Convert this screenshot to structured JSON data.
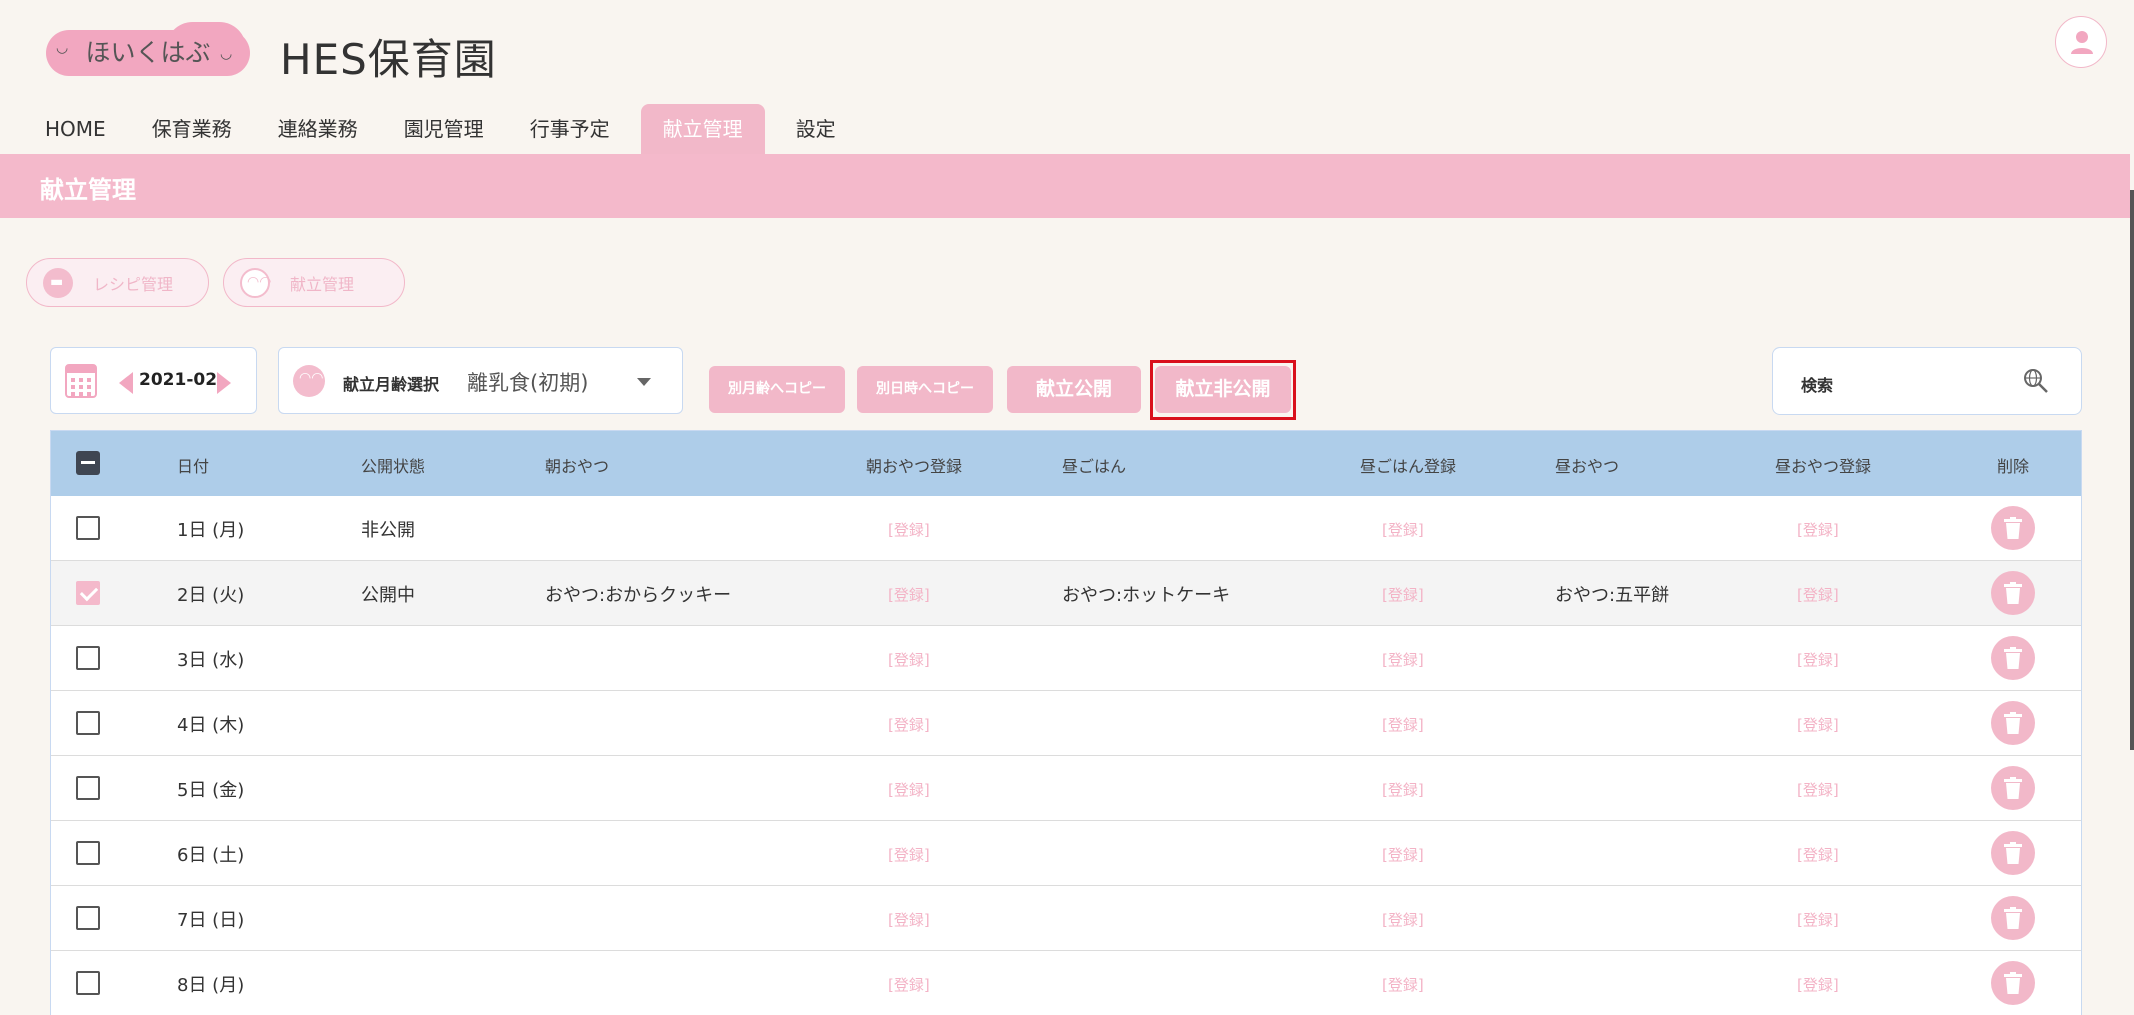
{
  "header": {
    "logo_text": "ほいくはぶ",
    "site_title": "HES保育園"
  },
  "nav": {
    "tabs": [
      "HOME",
      "保育業務",
      "連絡業務",
      "園児管理",
      "行事予定",
      "献立管理",
      "設定"
    ],
    "active_index": 5
  },
  "banner": {
    "title": "献立管理"
  },
  "sub_buttons": {
    "recipe": "レシピ管理",
    "menu": "献立管理"
  },
  "toolbar": {
    "month": "2021-02",
    "age_label": "献立月齢選択",
    "age_value": "離乳食(初期)",
    "copy_age": "別月齢へコピー",
    "copy_date": "別日時へコピー",
    "publish": "献立公開",
    "unpublish": "献立非公開",
    "search_label": "検索"
  },
  "table": {
    "columns": [
      "日付",
      "公開状態",
      "朝おやつ",
      "朝おやつ登録",
      "昼ごはん",
      "昼ごはん登録",
      "昼おやつ",
      "昼おやつ登録",
      "削除"
    ],
    "register_label": "[登録]",
    "rows": [
      {
        "date": "1日 (月)",
        "status": "非公開",
        "morning_snack": "",
        "lunch": "",
        "afternoon_snack": "",
        "checked": false
      },
      {
        "date": "2日 (火)",
        "status": "公開中",
        "morning_snack": "おやつ:おからクッキー",
        "lunch": "おやつ:ホットケーキ",
        "afternoon_snack": "おやつ:五平餅",
        "checked": true
      },
      {
        "date": "3日 (水)",
        "status": "",
        "morning_snack": "",
        "lunch": "",
        "afternoon_snack": "",
        "checked": false
      },
      {
        "date": "4日 (木)",
        "status": "",
        "morning_snack": "",
        "lunch": "",
        "afternoon_snack": "",
        "checked": false
      },
      {
        "date": "5日 (金)",
        "status": "",
        "morning_snack": "",
        "lunch": "",
        "afternoon_snack": "",
        "checked": false
      },
      {
        "date": "6日 (土)",
        "status": "",
        "morning_snack": "",
        "lunch": "",
        "afternoon_snack": "",
        "checked": false
      },
      {
        "date": "7日 (日)",
        "status": "",
        "morning_snack": "",
        "lunch": "",
        "afternoon_snack": "",
        "checked": false
      },
      {
        "date": "8日 (月)",
        "status": "",
        "morning_snack": "",
        "lunch": "",
        "afternoon_snack": "",
        "checked": false
      }
    ]
  },
  "colors": {
    "accent_pink": "#f2b8c9",
    "table_header": "#aecde9",
    "highlight_border": "#d9101c",
    "background": "#f9f5f0"
  }
}
